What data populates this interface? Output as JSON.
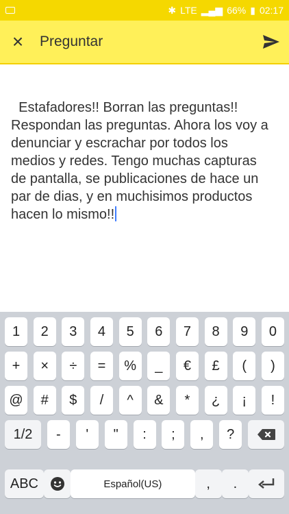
{
  "status": {
    "battery": "66%",
    "time": "02:17",
    "network": "LTE"
  },
  "appbar": {
    "title": "Preguntar",
    "close_label": "×"
  },
  "question": {
    "text": "Estafadores!! Borran las preguntas!! Respondan las preguntas. Ahora los voy a denunciar y escrachar por todos los medios y redes. Tengo muchas capturas de pantalla, se publicaciones de hace un par de dias, y en muchisimos productos hacen lo mismo!!"
  },
  "keyboard": {
    "row1": [
      "1",
      "2",
      "3",
      "4",
      "5",
      "6",
      "7",
      "8",
      "9",
      "0"
    ],
    "row2": [
      "+",
      "×",
      "÷",
      "=",
      "%",
      "_",
      "€",
      "£",
      "(",
      ")"
    ],
    "row3": [
      "@",
      "#",
      "$",
      "/",
      "^",
      "&",
      "*",
      "¿",
      "¡",
      "!"
    ],
    "row4": [
      "1/2",
      "-",
      "'",
      "\"",
      ":",
      ";",
      ",",
      "?"
    ],
    "space_label": "Español(US)",
    "abc_label": "ABC",
    "comma_label": ",",
    "dot_label": "."
  }
}
